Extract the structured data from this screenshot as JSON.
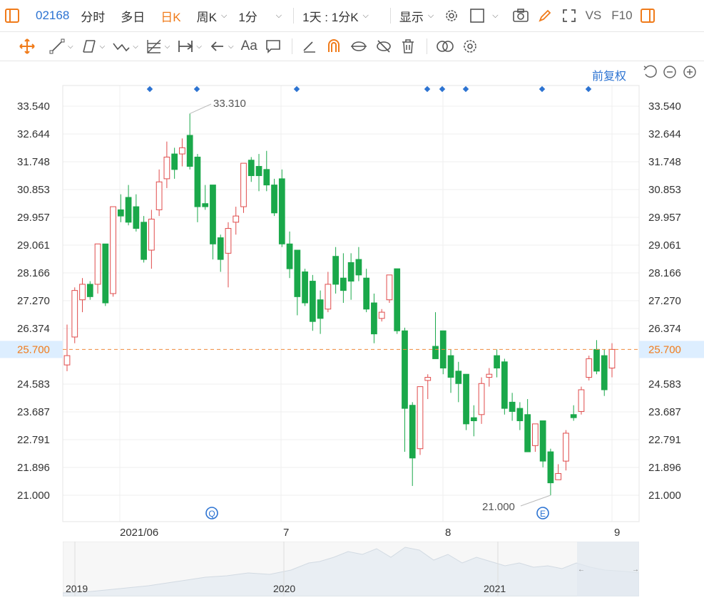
{
  "toolbar": {
    "code": "02168",
    "tabs": [
      "分时",
      "多日",
      "日K",
      "周K",
      "1分"
    ],
    "active_tab": "日K",
    "period_select": "1天 : 1分K",
    "display_label": "显示",
    "vs_label": "VS",
    "f10_label": "F10"
  },
  "drawing_tools": {
    "text_tool_label": "Aa"
  },
  "adjust_label": "前复权",
  "chart_data": {
    "type": "candlestick",
    "price_ticks": [
      "33.540",
      "32.644",
      "31.748",
      "30.853",
      "29.957",
      "29.061",
      "28.166",
      "27.270",
      "26.374",
      "25.700",
      "24.583",
      "23.687",
      "22.791",
      "21.896",
      "21.000"
    ],
    "ylim": [
      21.0,
      33.54
    ],
    "x_labels": [
      "2021/06",
      "7",
      "8",
      "9"
    ],
    "current_price": "25.700",
    "high_label": "33.310",
    "low_label": "21.000",
    "event_markers": [
      "Q",
      "E"
    ],
    "candles": [
      {
        "o": 25.2,
        "h": 26.5,
        "l": 25.0,
        "c": 25.5
      },
      {
        "o": 26.1,
        "h": 27.7,
        "l": 25.9,
        "c": 27.6
      },
      {
        "o": 27.3,
        "h": 28.0,
        "l": 26.9,
        "c": 27.8
      },
      {
        "o": 27.8,
        "h": 27.9,
        "l": 27.3,
        "c": 27.4
      },
      {
        "o": 27.8,
        "h": 29.1,
        "l": 27.5,
        "c": 29.1
      },
      {
        "o": 29.1,
        "h": 29.1,
        "l": 27.1,
        "c": 27.2
      },
      {
        "o": 27.5,
        "h": 30.3,
        "l": 27.4,
        "c": 30.3
      },
      {
        "o": 30.2,
        "h": 30.7,
        "l": 29.8,
        "c": 30.0
      },
      {
        "o": 30.6,
        "h": 31.0,
        "l": 29.7,
        "c": 29.8
      },
      {
        "o": 30.3,
        "h": 30.7,
        "l": 29.5,
        "c": 29.6
      },
      {
        "o": 29.8,
        "h": 30.0,
        "l": 28.5,
        "c": 28.6
      },
      {
        "o": 28.9,
        "h": 30.2,
        "l": 28.3,
        "c": 29.9
      },
      {
        "o": 30.2,
        "h": 31.5,
        "l": 30.0,
        "c": 31.1
      },
      {
        "o": 31.2,
        "h": 32.4,
        "l": 30.9,
        "c": 31.9
      },
      {
        "o": 32.0,
        "h": 32.2,
        "l": 31.2,
        "c": 31.5
      },
      {
        "o": 32.0,
        "h": 32.5,
        "l": 31.6,
        "c": 32.2
      },
      {
        "o": 32.6,
        "h": 33.3,
        "l": 31.5,
        "c": 31.6
      },
      {
        "o": 31.9,
        "h": 32.0,
        "l": 29.8,
        "c": 30.3
      },
      {
        "o": 30.4,
        "h": 31.0,
        "l": 30.2,
        "c": 30.3
      },
      {
        "o": 31.0,
        "h": 31.0,
        "l": 28.6,
        "c": 29.1
      },
      {
        "o": 29.3,
        "h": 29.4,
        "l": 28.2,
        "c": 28.6
      },
      {
        "o": 28.8,
        "h": 29.8,
        "l": 27.7,
        "c": 29.6
      },
      {
        "o": 29.8,
        "h": 30.3,
        "l": 29.4,
        "c": 30.0
      },
      {
        "o": 30.3,
        "h": 31.5,
        "l": 30.1,
        "c": 31.7
      },
      {
        "o": 31.8,
        "h": 31.9,
        "l": 31.1,
        "c": 31.3
      },
      {
        "o": 31.6,
        "h": 32.0,
        "l": 30.8,
        "c": 31.3
      },
      {
        "o": 31.5,
        "h": 32.1,
        "l": 30.8,
        "c": 31.0
      },
      {
        "o": 31.0,
        "h": 31.2,
        "l": 30.0,
        "c": 30.1
      },
      {
        "o": 31.2,
        "h": 31.5,
        "l": 29.0,
        "c": 29.1
      },
      {
        "o": 29.1,
        "h": 29.5,
        "l": 28.0,
        "c": 28.3
      },
      {
        "o": 28.9,
        "h": 28.9,
        "l": 26.8,
        "c": 27.4
      },
      {
        "o": 28.2,
        "h": 28.3,
        "l": 27.1,
        "c": 27.2
      },
      {
        "o": 27.9,
        "h": 28.1,
        "l": 26.3,
        "c": 26.6
      },
      {
        "o": 27.3,
        "h": 27.6,
        "l": 26.2,
        "c": 26.7
      },
      {
        "o": 27.0,
        "h": 28.2,
        "l": 26.9,
        "c": 27.8
      },
      {
        "o": 28.7,
        "h": 29.0,
        "l": 27.5,
        "c": 27.8
      },
      {
        "o": 28.0,
        "h": 28.8,
        "l": 27.2,
        "c": 27.6
      },
      {
        "o": 28.5,
        "h": 28.8,
        "l": 27.3,
        "c": 27.9
      },
      {
        "o": 28.6,
        "h": 29.0,
        "l": 27.9,
        "c": 28.1
      },
      {
        "o": 28.0,
        "h": 28.3,
        "l": 26.9,
        "c": 27.0
      },
      {
        "o": 27.2,
        "h": 27.5,
        "l": 25.9,
        "c": 26.2
      },
      {
        "o": 26.7,
        "h": 27.0,
        "l": 26.6,
        "c": 26.9
      },
      {
        "o": 27.3,
        "h": 28.1,
        "l": 27.2,
        "c": 28.1
      },
      {
        "o": 28.3,
        "h": 28.3,
        "l": 26.2,
        "c": 26.3
      },
      {
        "o": 26.3,
        "h": 26.4,
        "l": 22.4,
        "c": 23.8
      },
      {
        "o": 23.9,
        "h": 24.0,
        "l": 21.3,
        "c": 22.2
      },
      {
        "o": 22.5,
        "h": 24.5,
        "l": 22.3,
        "c": 24.5
      },
      {
        "o": 24.7,
        "h": 24.9,
        "l": 24.1,
        "c": 24.8
      },
      {
        "o": 25.8,
        "h": 26.9,
        "l": 25.4,
        "c": 25.4
      },
      {
        "o": 26.3,
        "h": 26.3,
        "l": 24.9,
        "c": 25.1
      },
      {
        "o": 25.5,
        "h": 25.7,
        "l": 24.3,
        "c": 24.8
      },
      {
        "o": 25.0,
        "h": 25.3,
        "l": 24.0,
        "c": 24.6
      },
      {
        "o": 24.9,
        "h": 24.9,
        "l": 23.1,
        "c": 23.3
      },
      {
        "o": 23.5,
        "h": 23.9,
        "l": 22.9,
        "c": 23.4
      },
      {
        "o": 23.6,
        "h": 24.8,
        "l": 23.3,
        "c": 24.6
      },
      {
        "o": 24.8,
        "h": 25.1,
        "l": 24.5,
        "c": 24.9
      },
      {
        "o": 25.5,
        "h": 25.7,
        "l": 24.8,
        "c": 25.1
      },
      {
        "o": 25.3,
        "h": 25.4,
        "l": 23.6,
        "c": 23.8
      },
      {
        "o": 24.0,
        "h": 24.3,
        "l": 23.4,
        "c": 23.7
      },
      {
        "o": 23.8,
        "h": 24.0,
        "l": 23.1,
        "c": 23.4
      },
      {
        "o": 23.6,
        "h": 24.1,
        "l": 22.4,
        "c": 22.4
      },
      {
        "o": 22.6,
        "h": 23.3,
        "l": 22.4,
        "c": 23.3
      },
      {
        "o": 23.4,
        "h": 23.4,
        "l": 21.9,
        "c": 22.1
      },
      {
        "o": 22.4,
        "h": 22.5,
        "l": 21.0,
        "c": 21.4
      },
      {
        "o": 21.5,
        "h": 22.0,
        "l": 21.5,
        "c": 21.7
      },
      {
        "o": 22.1,
        "h": 23.1,
        "l": 21.8,
        "c": 23.0
      },
      {
        "o": 23.6,
        "h": 23.9,
        "l": 23.4,
        "c": 23.5
      },
      {
        "o": 23.7,
        "h": 24.5,
        "l": 23.6,
        "c": 24.4
      },
      {
        "o": 24.8,
        "h": 25.5,
        "l": 24.7,
        "c": 25.4
      },
      {
        "o": 25.7,
        "h": 26.0,
        "l": 24.9,
        "c": 25.0
      },
      {
        "o": 25.5,
        "h": 25.7,
        "l": 24.2,
        "c": 24.4
      },
      {
        "o": 25.1,
        "h": 25.9,
        "l": 24.8,
        "c": 25.7
      }
    ]
  },
  "navigator": {
    "year_labels": [
      "2019",
      "2020",
      "2021"
    ]
  },
  "colors": {
    "up": "#e04b4b",
    "down": "#1aa84a",
    "price_line": "#ef8a3c",
    "current_bg": "#ddeeff",
    "accent": "#2c73d2",
    "orange": "#f07b1a"
  }
}
